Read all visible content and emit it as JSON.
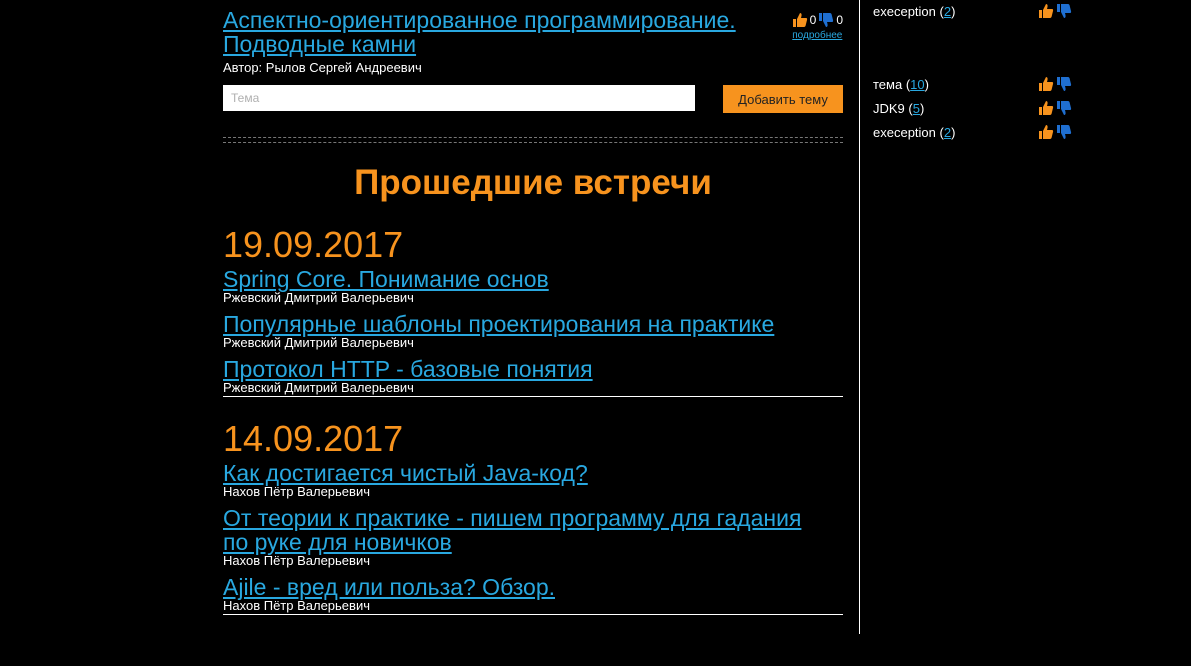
{
  "current_topic": {
    "title": "Аспектно-ориентированное программирование. Подводные камни",
    "author": "Автор: Рылов Сергей Андреевич",
    "likes": "0",
    "dislikes": "0",
    "more_link": "подробнее"
  },
  "add_topic": {
    "placeholder": "Тема",
    "button_label": "Добавить тему"
  },
  "past": {
    "heading": "Прошедшие встречи",
    "meetings": [
      {
        "date": "19.09.2017",
        "talks": [
          {
            "title": "Spring Core. Понимание основ",
            "author": "Ржевский Дмитрий Валерьевич"
          },
          {
            "title": "Популярные шаблоны проектирования на практике",
            "author": "Ржевский Дмитрий Валерьевич"
          },
          {
            "title": "Протокол HTTP - базовые понятия",
            "author": "Ржевский Дмитрий Валерьевич"
          }
        ]
      },
      {
        "date": "14.09.2017",
        "talks": [
          {
            "title": "Как достигается чистый Java-код?",
            "author": "Нахов Пётр Валерьевич"
          },
          {
            "title": "От теории к практике - пишем программу для гадания по руке для новичков",
            "author": "Нахов Пётр Валерьевич"
          },
          {
            "title": "Ajile - вред или польза? Обзор.",
            "author": "Нахов Пётр Валерьевич"
          }
        ]
      }
    ]
  },
  "sidebar": {
    "top_tags": [
      {
        "name": "exeception",
        "count": "2"
      }
    ],
    "tags": [
      {
        "name": "тема",
        "count": "10"
      },
      {
        "name": "JDK9",
        "count": "5"
      },
      {
        "name": "exeception",
        "count": "2"
      }
    ]
  },
  "colors": {
    "accent": "#f7931e",
    "link": "#29a8e0",
    "thumb_up": "#f7931e",
    "thumb_down": "#1f6fd1"
  },
  "icons": {
    "like": "thumbs-up-icon",
    "dislike": "thumbs-down-icon"
  }
}
